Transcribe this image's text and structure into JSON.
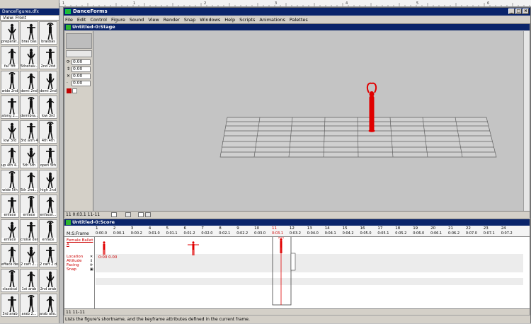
{
  "palette": {
    "title": "DanceFigures.dfx",
    "view": "View: Front",
    "cells": [
      "preparat...",
      "bras bas",
      "brasbas",
      "fal' fift",
      "5thenav...",
      "2nd 2nd",
      "wide 2nd",
      "demi 2nd",
      "demi 2nd",
      "along 2...",
      "demibra...",
      "low 3rd",
      "low 3rd",
      "3rd arm 4th",
      "4th 4th",
      "up 4th 4...",
      "5th 5th",
      "open 5th",
      "wide 5th",
      "5th 2nd...",
      "high 2nd",
      "enface",
      "enface",
      "enfacel...",
      "enface",
      "croisé der",
      "enface",
      "effacé der",
      "2 cart 2...",
      "2 cart 2 der",
      "classical",
      "1st arab",
      "2nd arab",
      "3rd arab",
      "arab 2...",
      "arab allo..."
    ]
  },
  "ruler_labels": [
    "1",
    "1",
    "2",
    "3",
    "4",
    "5",
    "6"
  ],
  "app": {
    "title": "DanceForms",
    "menu": [
      "File",
      "Edit",
      "Control",
      "Figure",
      "Sound",
      "View",
      "Render",
      "Snap",
      "Windows",
      "Help",
      "Scripts",
      "Animations",
      "Palettes"
    ],
    "window_buttons": [
      "_",
      "□",
      "×"
    ]
  },
  "stage": {
    "title": "Untitled-0:Stage",
    "fields": [
      "0.00",
      "0.00",
      "0.00",
      "0.00"
    ],
    "field_icons": [
      "rotate-icon",
      "tilt-icon",
      "scale-icon",
      "zoom-icon"
    ],
    "status": "11 0:03.1 11-11"
  },
  "score": {
    "title": "Untitled-0:Score",
    "header_label": "M:S:Frame",
    "figure_name": "Female Ballet A",
    "tracks": [
      "Location",
      "Altitude",
      "Facing",
      "Snap"
    ],
    "frames": [
      "1",
      "2",
      "3",
      "4",
      "5",
      "6",
      "7",
      "8",
      "9",
      "10",
      "11",
      "12",
      "13",
      "14",
      "15",
      "16",
      "17",
      "18",
      "19",
      "20",
      "21",
      "22",
      "23",
      "24"
    ],
    "times": [
      "0:00.0",
      "0:00.1",
      "0:00.2",
      "0:01.0",
      "0:01.1",
      "0:01.2",
      "0:02.0",
      "0:02.1",
      "0:02.2",
      "0:03.0",
      "0:03.1",
      "0:03.2",
      "0:04.0",
      "0:04.1",
      "0:04.2",
      "0:05.0",
      "0:05.1",
      "0:05.2",
      "0:06.0",
      "0:06.1",
      "0:06.2",
      "0:07.0",
      "0:07.1",
      "0:07.2"
    ],
    "current_frame": "11",
    "current_time": "0:03.1",
    "keyframe_readout": "0:00 0.00",
    "status": "11 11-11"
  },
  "app_status": "Lists the figure's shortname, and the keyframe attributes defined in the current frame.",
  "colors": {
    "accent": "#0a246a",
    "figure": "#e00000"
  }
}
